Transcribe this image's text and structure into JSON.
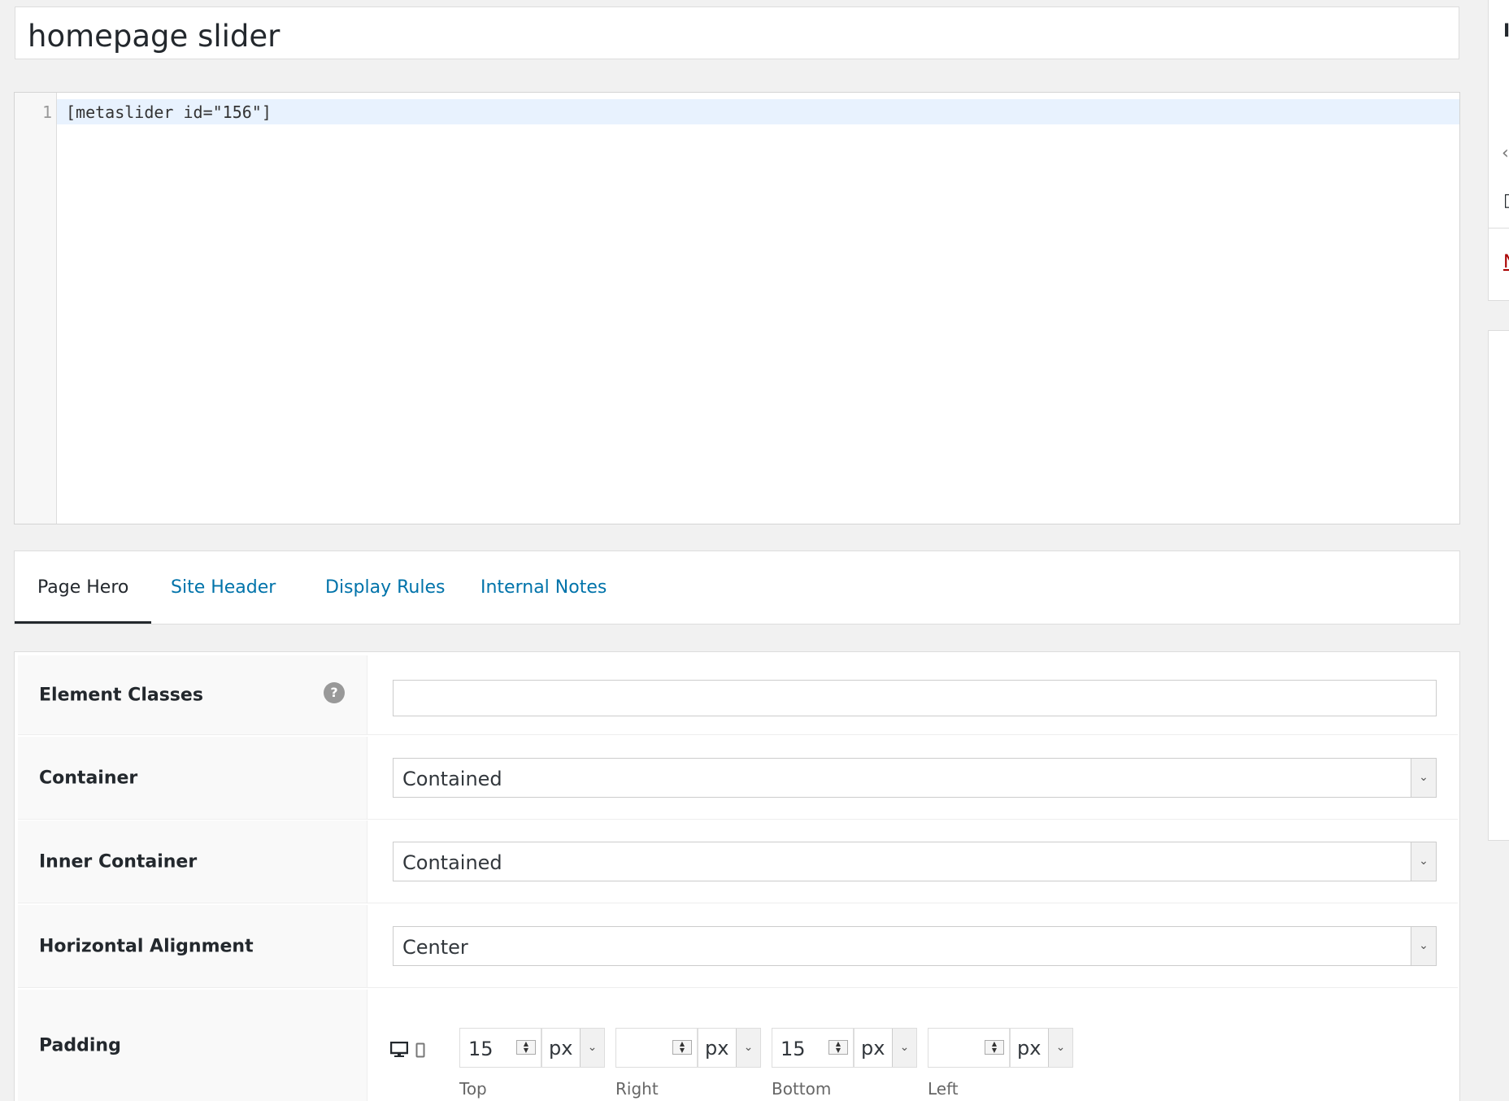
{
  "title": "homepage slider",
  "editor": {
    "line_number": "1",
    "code": "[metaslider id=\"156\"]"
  },
  "tabs": [
    {
      "label": "Page Hero"
    },
    {
      "label": "Site Header"
    },
    {
      "label": "Display Rules"
    },
    {
      "label": "Internal Notes"
    }
  ],
  "settings": {
    "element_classes": {
      "label": "Element Classes",
      "help": "?",
      "value": ""
    },
    "container": {
      "label": "Container",
      "value": "Contained"
    },
    "inner_container": {
      "label": "Inner Container",
      "value": "Contained"
    },
    "horizontal_alignment": {
      "label": "Horizontal Alignment",
      "value": "Center"
    },
    "padding": {
      "label": "Padding",
      "top": {
        "value": "15",
        "unit": "px",
        "label": "Top"
      },
      "right": {
        "value": "",
        "unit": "px",
        "label": "Right"
      },
      "bottom": {
        "value": "15",
        "unit": "px",
        "label": "Bottom"
      },
      "left": {
        "value": "",
        "unit": "px",
        "label": "Left"
      }
    }
  },
  "icons": {
    "desktop": "desktop-icon",
    "mobile": "mobile-icon",
    "help": "help-icon",
    "caret": "chevron-down-icon"
  },
  "colors": {
    "link": "#0073aa",
    "active_line": "#e8f2fe",
    "sidebar_link": "#a00"
  },
  "sidebar": {
    "glyph_top": "I",
    "glyph_link": "N"
  }
}
